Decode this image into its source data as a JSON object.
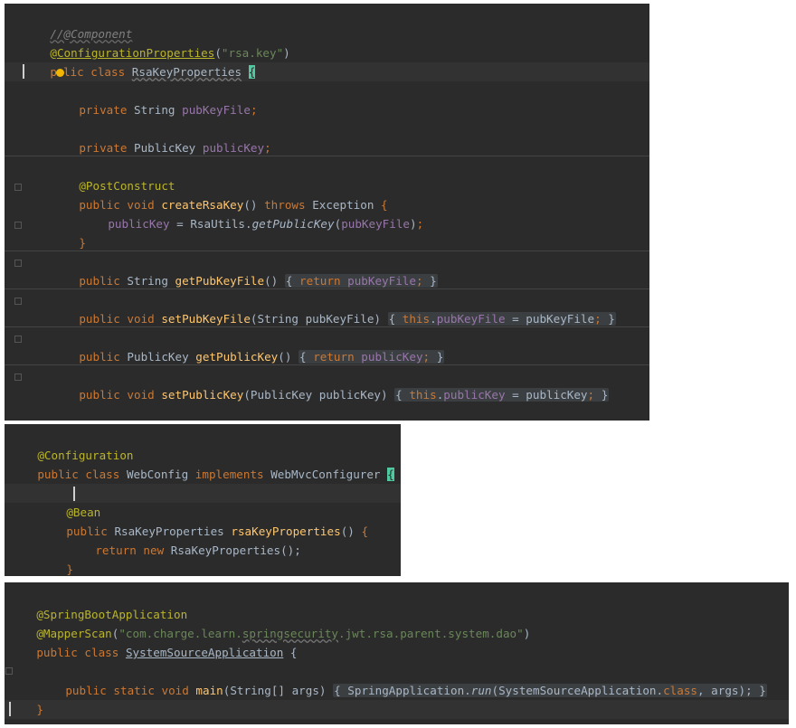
{
  "panel1": {
    "comment": "//@Component",
    "annotation_at": "@",
    "config_props": "ConfigurationProperties",
    "config_props_arg": "\"rsa.key\"",
    "class_kw": "lic class",
    "class_p": "p",
    "class_name": "RsaKeyProperties",
    "private_kw": "private",
    "pub_key_file_type": "String",
    "pub_key_file_field": "pubKeyFile",
    "public_key_type": "PublicKey",
    "public_key_field": "publicKey",
    "post_construct": "@PostConstruct",
    "create_sig_pub": "public void",
    "create_name": "createRsaKey",
    "throws_kw": "throws",
    "exception": "Exception",
    "body_left": "publicKey",
    "body_mid": " = RsaUtils.",
    "body_method": "getPublicKey",
    "body_arg": "pubKeyFile",
    "get_pub_key_file_name": "getPubKeyFile",
    "set_pub_key_file_name": "setPubKeyFile",
    "get_public_key_name": "getPublicKey",
    "set_public_key_name": "setPublicKey",
    "return_kw": "return",
    "this_kw": "this"
  },
  "panel2": {
    "configuration": "@Configuration",
    "class_decl_kw": "public class",
    "class_name": "WebConfig",
    "implements_kw": "implements",
    "interface_name": "WebMvcConfigurer",
    "bean": "@Bean",
    "method_type": "RsaKeyProperties",
    "method_name": "rsaKeyProperties",
    "return_new": "return new",
    "ctor": "RsaKeyProperties();"
  },
  "panel3": {
    "spring_boot_app": "@SpringBootApplication",
    "mapper_scan": "@MapperScan",
    "mapper_pkg_a": "\"com.charge.learn.",
    "mapper_pkg_b": "springsecurity",
    "mapper_pkg_c": ".jwt.rsa.parent.system.dao\"",
    "class_decl_kw": "public class",
    "class_name": "SystemSourceApplication",
    "main_kw": "public static void",
    "main_name": "main",
    "main_params": "(String[] args)",
    "spring_app": "SpringApplication.",
    "run": "run",
    "run_args_a": "(SystemSourceApplication.",
    "class_kw": "class",
    "run_args_b": ", args);"
  }
}
